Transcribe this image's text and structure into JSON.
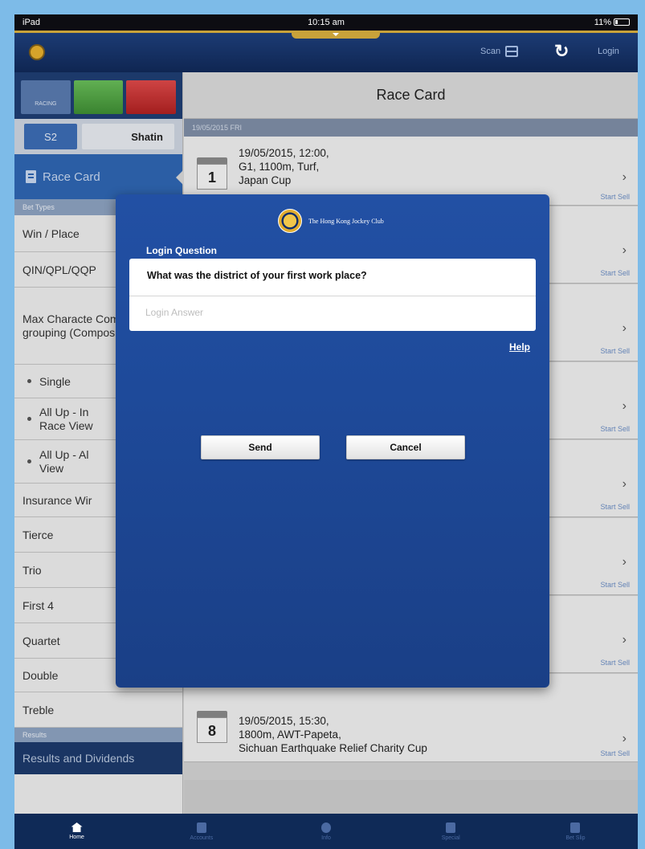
{
  "status_bar": {
    "device": "iPad",
    "time": "10:15 am",
    "battery": "11%"
  },
  "app_bar": {
    "logo_text": "",
    "scan_label": "Scan",
    "login_label": "Login"
  },
  "sidebar": {
    "tab_label": "RACING",
    "venue_code": "S2",
    "venue_name": "Shatin",
    "race_card_label": "Race Card",
    "bet_types_header": "Bet Types",
    "bet_types": [
      "Win / Place",
      "QIN/QPL/QQP",
      "Max Characte Composite W grouping (Composite W",
      "Single",
      "All Up - In Race View",
      "All Up - Al View",
      "Insurance Wir",
      "Tierce",
      "Trio",
      "First 4",
      "Quartet",
      "Double",
      "Treble"
    ],
    "results_header": "Results",
    "results_label": "Results and Dividends"
  },
  "main": {
    "title": "Race Card",
    "date_strip": "19/05/2015 FRI",
    "races": [
      {
        "number": "1",
        "line1": "19/05/2015, 12:00,",
        "line2": "G1, 1100m, Turf,",
        "line3": "Japan Cup",
        "start_sell": "Start Sell"
      },
      {
        "number": "8",
        "line1": "19/05/2015, 15:30,",
        "line2": "1800m, AWT-Papeta,",
        "line3": "Sichuan Earthquake Relief Charity Cup",
        "start_sell": "Start Sell"
      }
    ],
    "start_sell_label": "Start Sell"
  },
  "modal": {
    "org_name": "The Hong Kong Jockey Club",
    "section_label": "Login Question",
    "question": "What was the district of your first work place?",
    "answer_placeholder": "Login Answer",
    "answer_value": "",
    "help_label": "Help",
    "send_label": "Send",
    "cancel_label": "Cancel"
  },
  "tab_bar": {
    "items": [
      {
        "label": "Home",
        "icon": "home-icon",
        "active": true
      },
      {
        "label": "Accounts",
        "icon": "accounts-icon",
        "active": false
      },
      {
        "label": "Info",
        "icon": "info-icon",
        "active": false
      },
      {
        "label": "Special",
        "icon": "special-icon",
        "active": false
      },
      {
        "label": "Bet Slip",
        "icon": "betslip-icon",
        "active": false
      }
    ]
  },
  "colors": {
    "page_border": "#7dbbe8",
    "modal_blue": "#1e4a9a",
    "nav_blue": "#2f66b4",
    "dark_navy": "#0f2a57",
    "accent_gold": "#c9a23a"
  }
}
